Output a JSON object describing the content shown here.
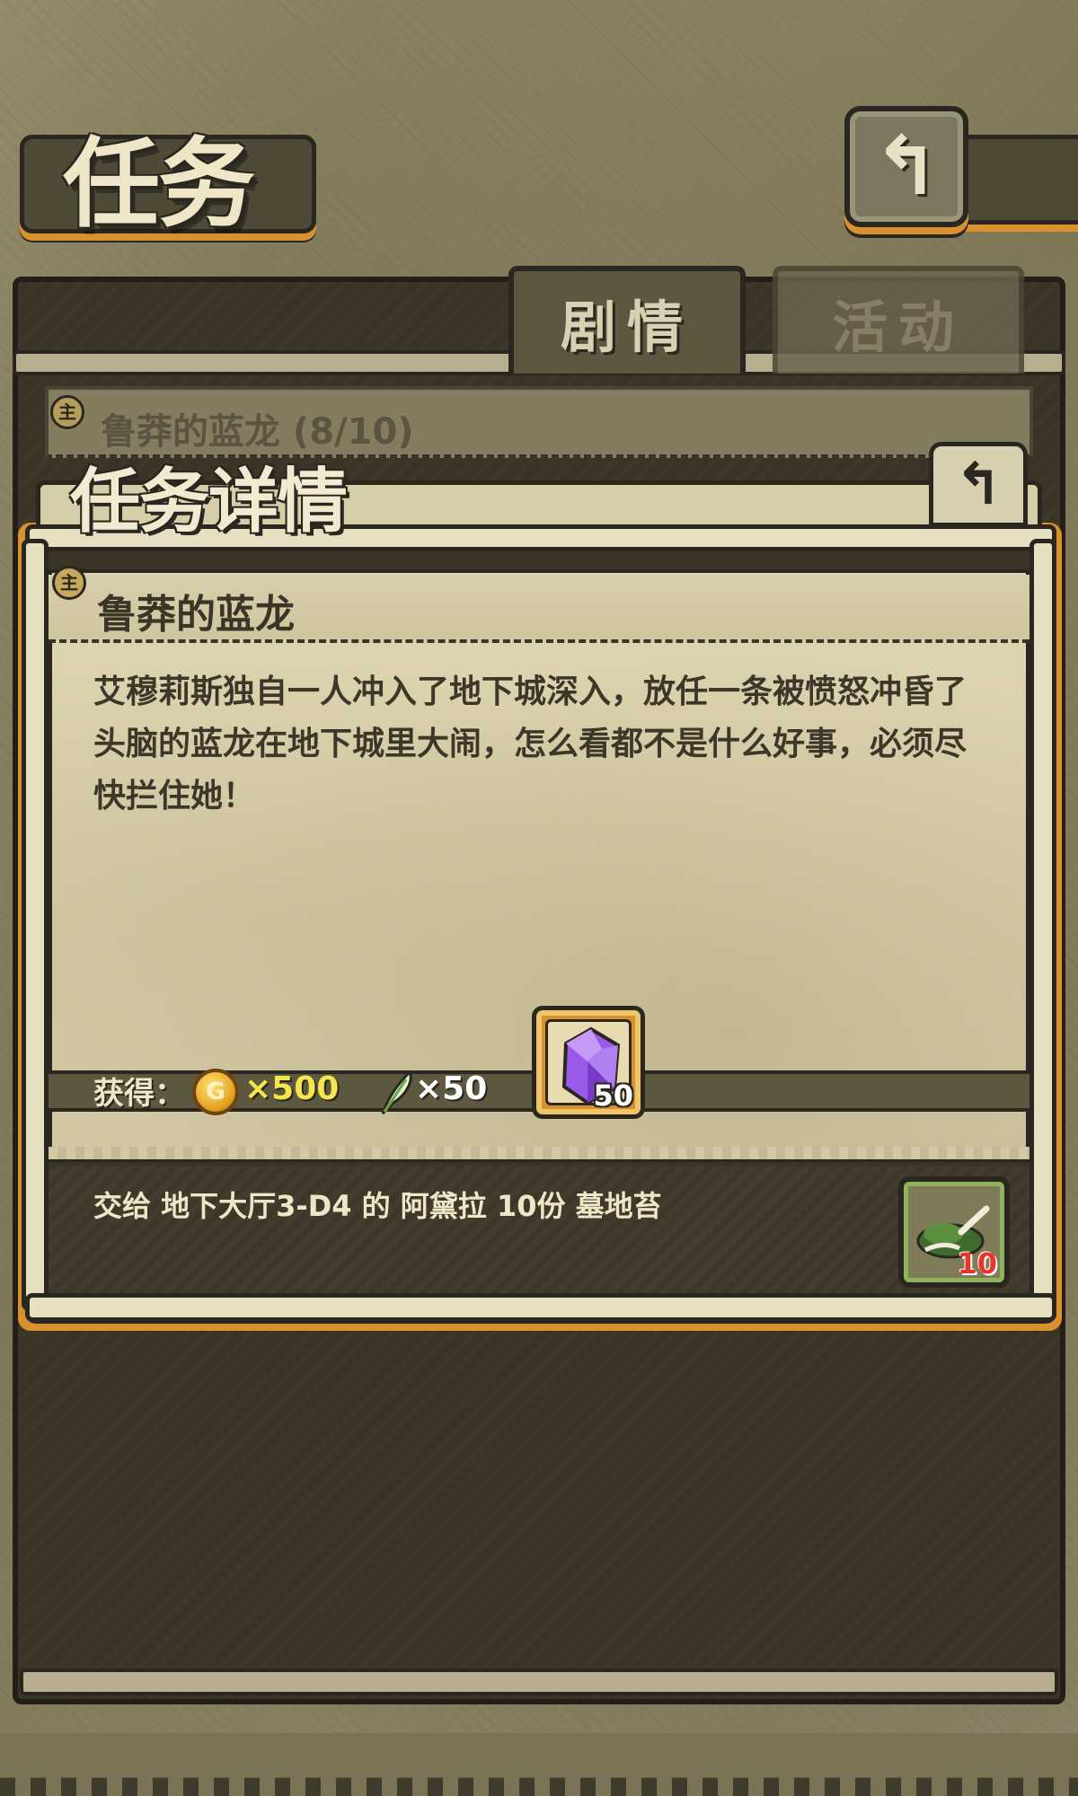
{
  "header": {
    "title": "任务",
    "back_icon": "back-arrow-icon"
  },
  "tabs": [
    {
      "label": "剧情",
      "active": true
    },
    {
      "label": "活动",
      "active": false
    }
  ],
  "quest_list": {
    "badge": "主",
    "item_title": "鲁莽的蓝龙 (8/10)"
  },
  "dialog": {
    "title": "任务详情",
    "back_icon": "back-arrow-icon",
    "quest": {
      "badge": "主",
      "name": "鲁莽的蓝龙",
      "description": "艾穆莉斯独自一人冲入了地下城深入，放任一条被愤怒冲昏了头脑的蓝龙在地下城里大闹，怎么看都不是什么好事，必须尽快拦住她！"
    },
    "rewards": {
      "label": "获得：",
      "coin_symbol": "G",
      "coin_amount": "×500",
      "feather_amount": "×50",
      "gem_count": "50"
    },
    "requirement": {
      "text": "交给 地下大厅3-D4  的 阿黛拉 10份 墓地苔",
      "item_count": "10"
    }
  },
  "colors": {
    "accent_orange": "#d9902f",
    "frame_dark": "#2a2720",
    "parchment": "#d7ceaa",
    "coin_text": "#f4e64c",
    "item_count_red": "#e8352a"
  }
}
